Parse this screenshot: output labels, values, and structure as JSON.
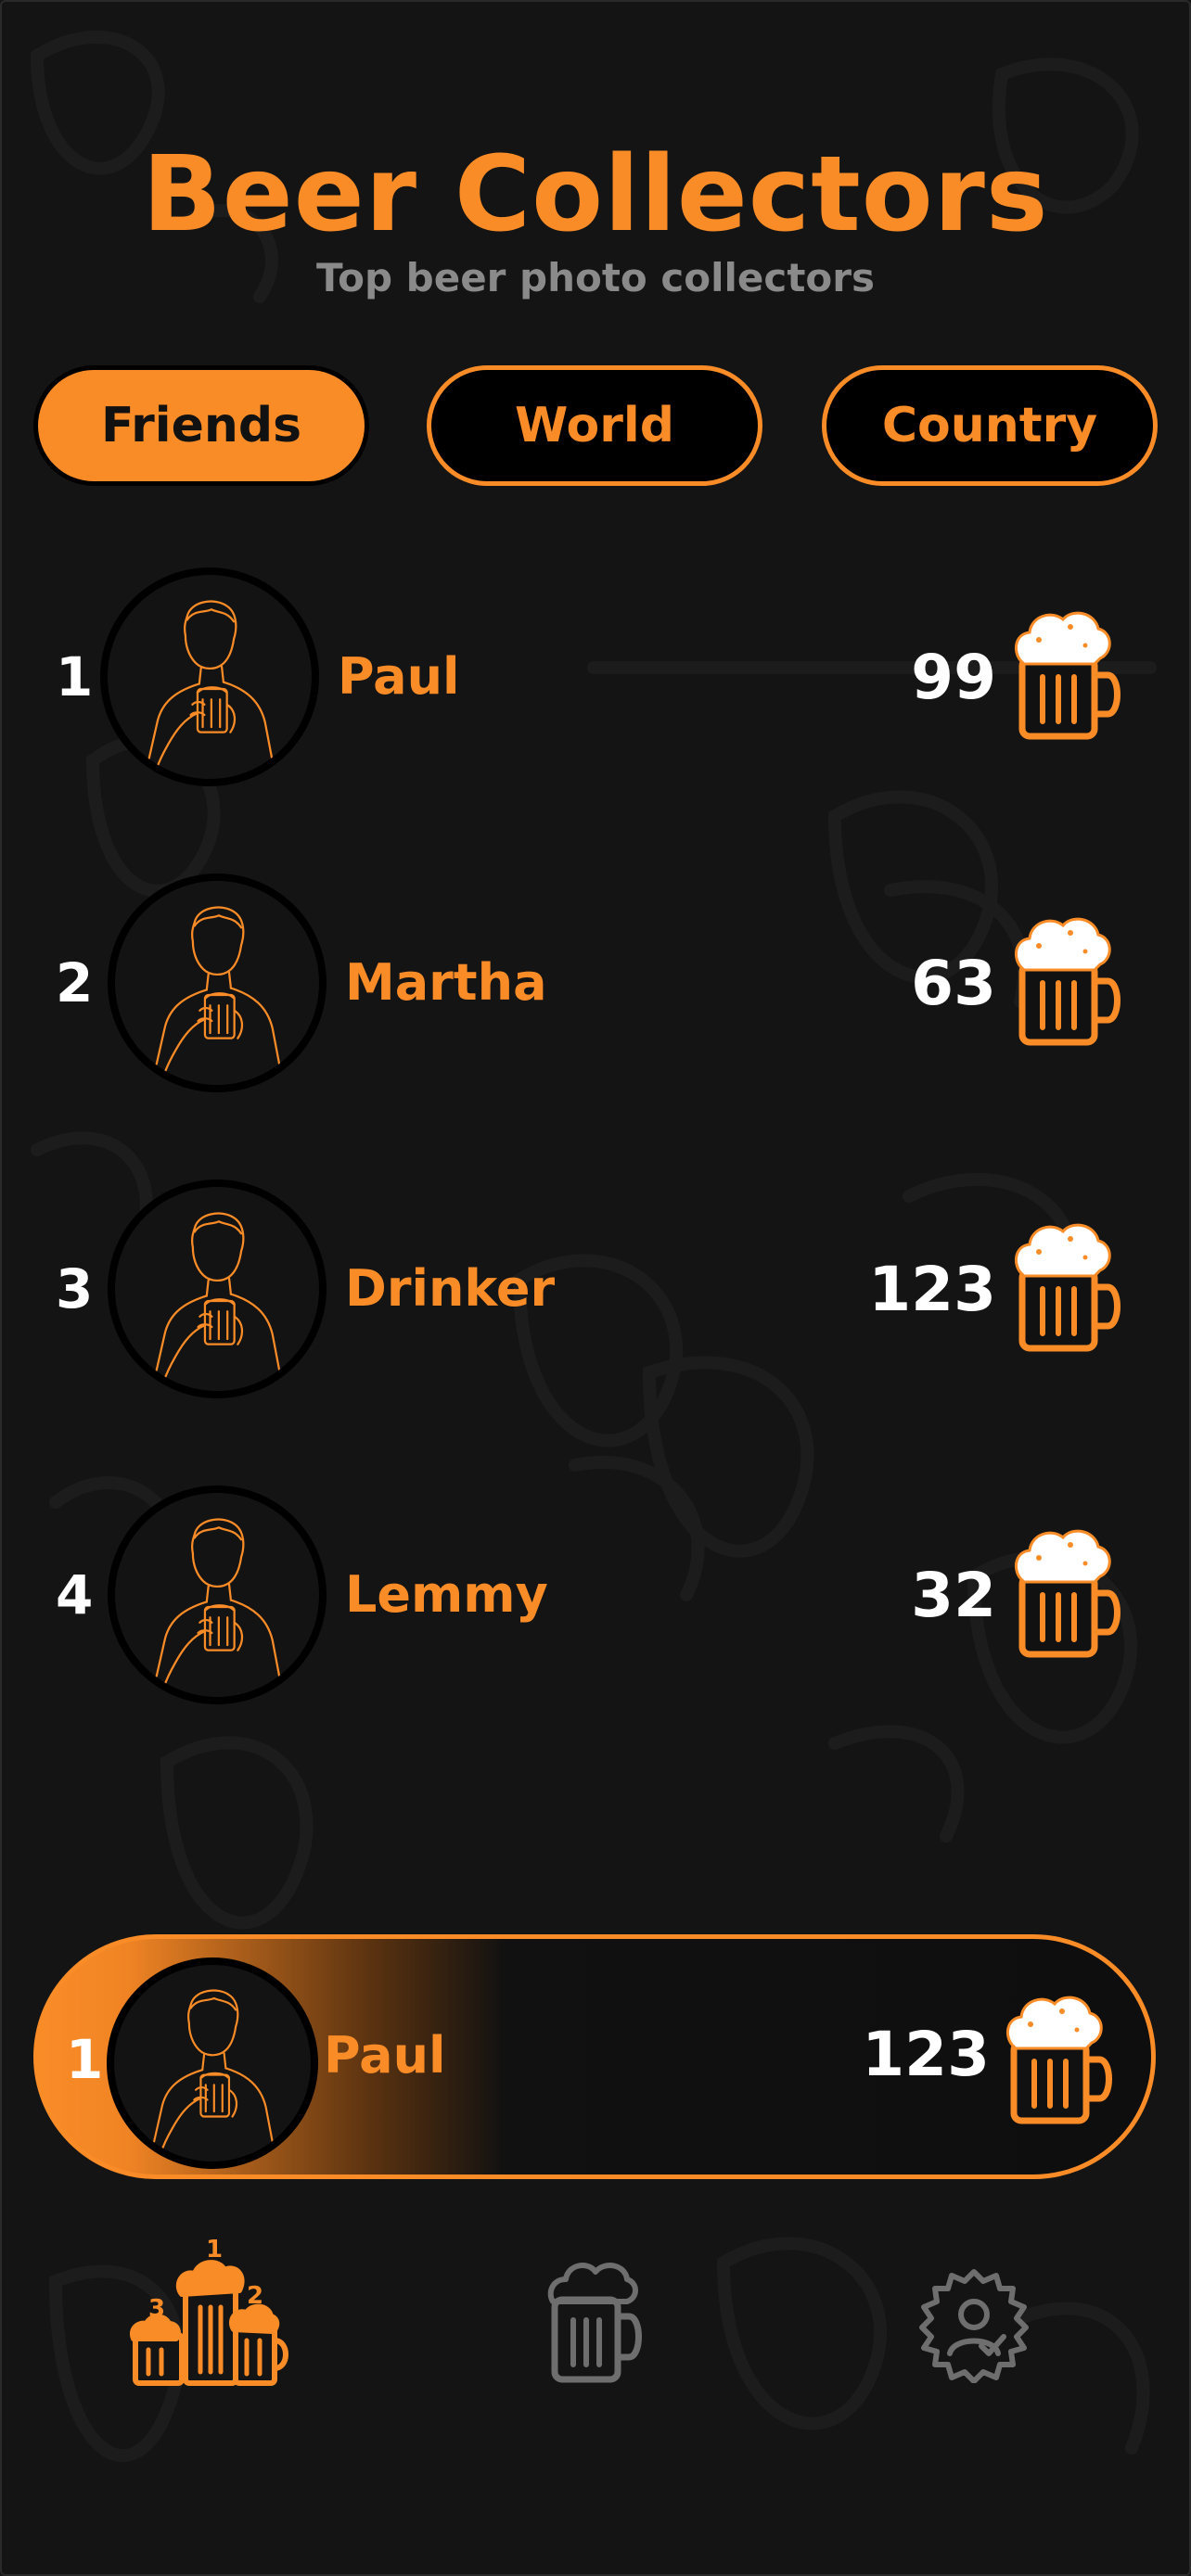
{
  "colors": {
    "accent": "#fa8c28",
    "background": "#141414",
    "muted": "#8a8a8a"
  },
  "header": {
    "title": "Beer Collectors",
    "subtitle": "Top beer photo collectors"
  },
  "tabs": [
    {
      "label": "Friends",
      "active": true
    },
    {
      "label": "World",
      "active": false
    },
    {
      "label": "Country",
      "active": false
    }
  ],
  "leaderboard": [
    {
      "rank": "1",
      "name": "Paul",
      "count": "99"
    },
    {
      "rank": "2",
      "name": "Martha",
      "count": "63"
    },
    {
      "rank": "3",
      "name": "Drinker",
      "count": "123"
    },
    {
      "rank": "4",
      "name": "Lemmy",
      "count": "32"
    }
  ],
  "current_user": {
    "rank": "1",
    "name": "Paul",
    "count": "123"
  },
  "bottom_nav": {
    "items": [
      {
        "icon": "leaderboard-podium-icon",
        "active": true,
        "podium_labels": [
          "1",
          "2",
          "3"
        ]
      },
      {
        "icon": "beer-mug-icon",
        "active": false
      },
      {
        "icon": "profile-badge-icon",
        "active": false
      }
    ]
  }
}
